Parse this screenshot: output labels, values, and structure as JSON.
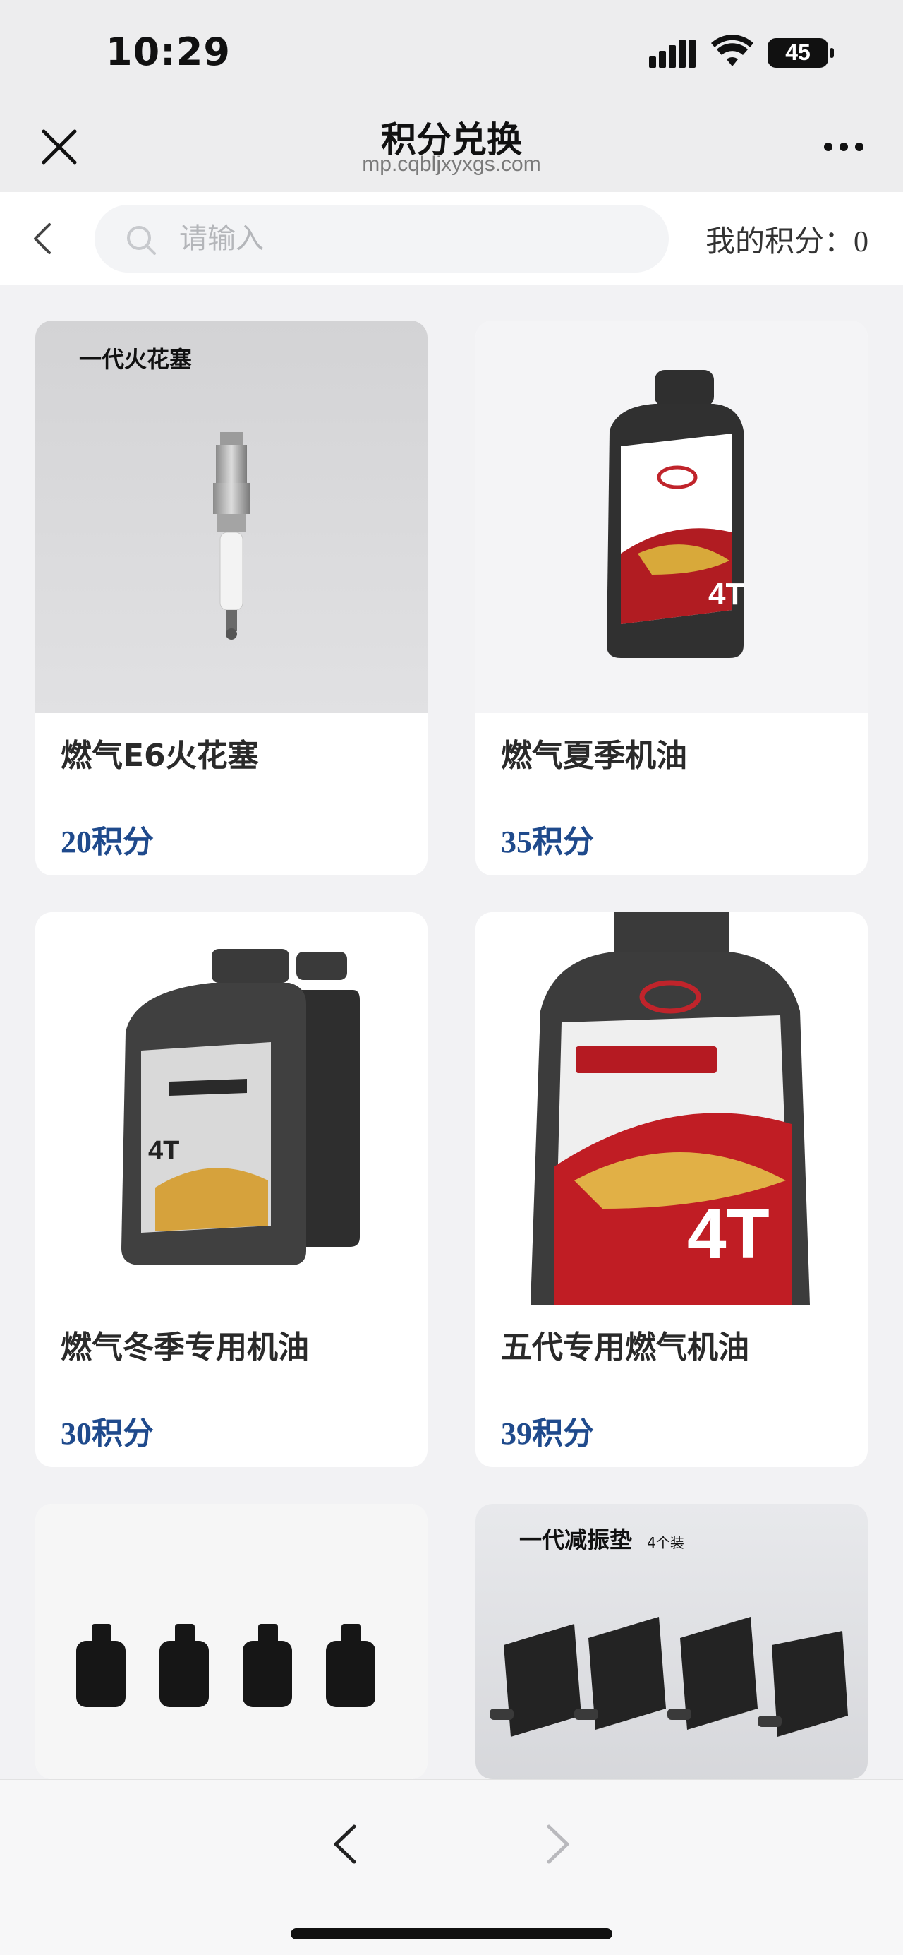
{
  "status_bar": {
    "time": "10:29",
    "battery": "45"
  },
  "header": {
    "title": "积分兑换",
    "url": "mp.cqbljxyxgs.com"
  },
  "search": {
    "placeholder": "请输入"
  },
  "points": {
    "label": "我的积分：",
    "value": "0"
  },
  "products": [
    {
      "name": "燃气E6火花塞",
      "price": "20积分",
      "image_caption": "一代火花塞"
    },
    {
      "name": "燃气夏季机油",
      "price": "35积分"
    },
    {
      "name": "燃气冬季专用机油",
      "price": "30积分"
    },
    {
      "name": "五代专用燃气机油",
      "price": "39积分"
    },
    {
      "name": "",
      "price": ""
    },
    {
      "name": "",
      "price": "",
      "image_caption": "一代减振垫",
      "image_caption_sub": "4个装"
    }
  ],
  "colors": {
    "price": "#1f4a8c",
    "background": "#f2f2f4",
    "card": "#ffffff"
  },
  "icons": [
    "signal-icon",
    "wifi-icon",
    "battery-icon",
    "close-icon",
    "more-icon",
    "back-chevron-icon",
    "search-icon",
    "nav-back-icon",
    "nav-forward-icon"
  ]
}
